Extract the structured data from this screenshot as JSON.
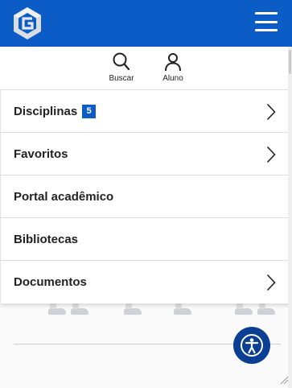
{
  "header": {
    "background_color": "#0b5cc7",
    "logo_icon": "brand-g-logo",
    "menu_icon": "hamburger-icon"
  },
  "topbar": {
    "search": {
      "label": "Buscar",
      "icon": "search-icon"
    },
    "student": {
      "label": "Aluno",
      "icon": "user-icon"
    }
  },
  "menu": {
    "items": [
      {
        "label": "Disciplinas",
        "badge": "5",
        "has_submenu": true
      },
      {
        "label": "Favoritos",
        "has_submenu": true
      },
      {
        "label": "Portal acadêmico",
        "has_submenu": false
      },
      {
        "label": "Bibliotecas",
        "has_submenu": false
      },
      {
        "label": "Documentos",
        "has_submenu": true
      }
    ]
  },
  "accessibility": {
    "icon": "accessibility-icon",
    "color": "#0b3f94"
  },
  "colors": {
    "accent": "#0b5cc7",
    "text": "#222222",
    "divider": "#dcdcdc"
  }
}
